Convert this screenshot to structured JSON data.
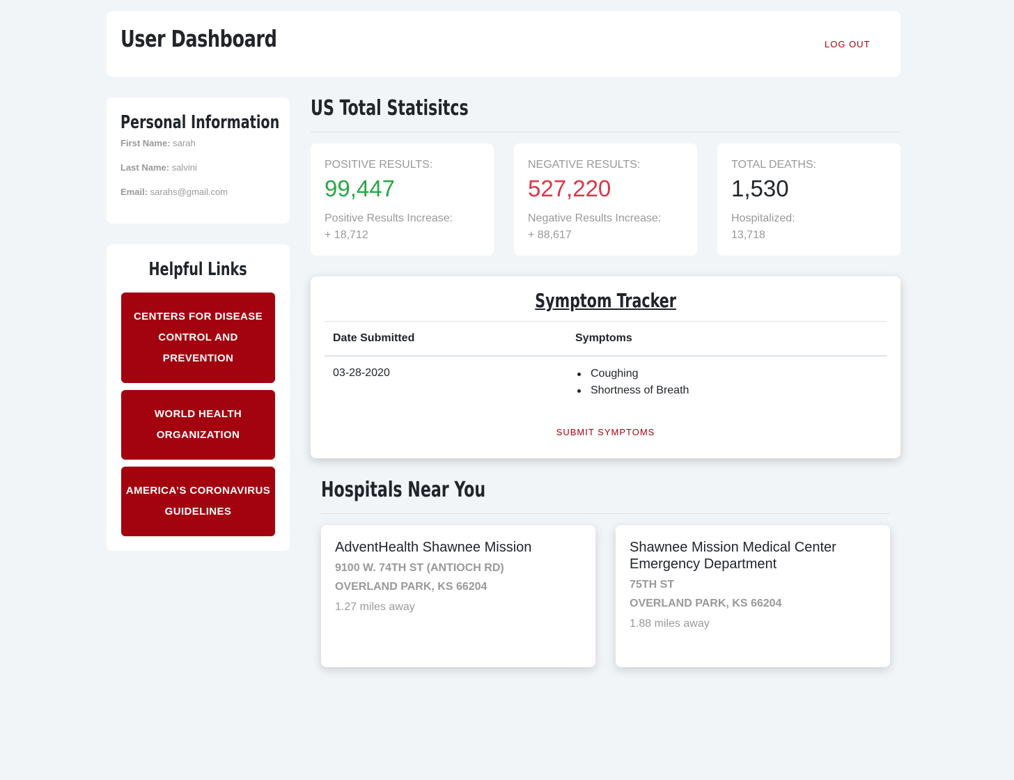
{
  "header": {
    "title": "User Dashboard",
    "logout_label": "LOG OUT"
  },
  "personal": {
    "title": "Personal Information",
    "first_name_label": "First Name:",
    "first_name": "sarah",
    "last_name_label": "Last Name:",
    "last_name": "salvini",
    "email_label": "Email:",
    "email": "sarahs@gmail.com"
  },
  "links": {
    "title": "Helpful Links",
    "items": [
      {
        "label": "Centers for Disease Control and Prevention"
      },
      {
        "label": "World Health Organization"
      },
      {
        "label": "America’s Coronavirus Guidelines"
      }
    ]
  },
  "stats": {
    "title": "US Total Statisitcs",
    "cards": [
      {
        "label": "Positive Results:",
        "value": "99,447",
        "sub_label": "Positive Results Increase:",
        "sub_value": "+ 18,712",
        "color": "#28a745"
      },
      {
        "label": "Negative Results:",
        "value": "527,220",
        "sub_label": "Negative Results Increase:",
        "sub_value": "+ 88,617",
        "color": "#dc3545"
      },
      {
        "label": "Total Deaths:",
        "value": "1,530",
        "sub_label": "Hospitalized:",
        "sub_value": "13,718",
        "color": "#212529"
      }
    ]
  },
  "tracker": {
    "title": "Symptom Tracker",
    "col_date": "Date Submitted",
    "col_symptoms": "Symptoms",
    "rows": [
      {
        "date": "03-28-2020",
        "symptoms": [
          "Coughing",
          "Shortness of Breath"
        ]
      }
    ],
    "submit_label": "SUBMIT SYMPTOMS"
  },
  "hospitals": {
    "title": "Hospitals Near You",
    "items": [
      {
        "name": "AdventHealth Shawnee Mission",
        "address1": "9100 W. 74th St (Antioch Rd)",
        "address2": "Overland Park, KS 66204",
        "distance": "1.27 miles away"
      },
      {
        "name": "Shawnee Mission Medical Center Emergency Department",
        "address1": "75th St",
        "address2": "Overland Park, KS 66204",
        "distance": "1.88 miles away"
      }
    ]
  },
  "colors": {
    "accent": "#a3030f",
    "background": "#f2f5f8",
    "muted": "#999999"
  }
}
